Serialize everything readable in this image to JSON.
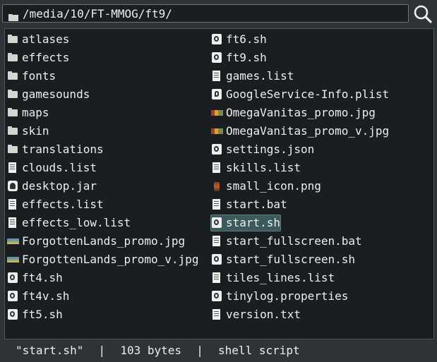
{
  "pathbar": {
    "path": "/media/10/FT-MMOG/ft9/",
    "folder_icon": "folder-icon",
    "search_icon": "search-icon"
  },
  "files": {
    "left": [
      {
        "name": "atlases",
        "icon": "folder"
      },
      {
        "name": "effects",
        "icon": "folder"
      },
      {
        "name": "fonts",
        "icon": "folder"
      },
      {
        "name": "gamesounds",
        "icon": "folder"
      },
      {
        "name": "maps",
        "icon": "folder"
      },
      {
        "name": "skin",
        "icon": "folder"
      },
      {
        "name": "translations",
        "icon": "folder"
      },
      {
        "name": "clouds.list",
        "icon": "text"
      },
      {
        "name": "desktop.jar",
        "icon": "jar"
      },
      {
        "name": "effects.list",
        "icon": "text"
      },
      {
        "name": "effects_low.list",
        "icon": "text"
      },
      {
        "name": "ForgottenLands_promo.jpg",
        "icon": "image"
      },
      {
        "name": "ForgottenLands_promo_v.jpg",
        "icon": "image"
      },
      {
        "name": "ft4.sh",
        "icon": "script"
      },
      {
        "name": "ft4v.sh",
        "icon": "script"
      },
      {
        "name": "ft5.sh",
        "icon": "script"
      }
    ],
    "right": [
      {
        "name": "ft6.sh",
        "icon": "script"
      },
      {
        "name": "ft9.sh",
        "icon": "script"
      },
      {
        "name": "games.list",
        "icon": "text"
      },
      {
        "name": "GoogleService-Info.plist",
        "icon": "plist"
      },
      {
        "name": "OmegaVanitas_promo.jpg",
        "icon": "image2"
      },
      {
        "name": "OmegaVanitas_promo_v.jpg",
        "icon": "image2"
      },
      {
        "name": "settings.json",
        "icon": "script"
      },
      {
        "name": "skills.list",
        "icon": "text"
      },
      {
        "name": "small_icon.png",
        "icon": "png"
      },
      {
        "name": "start.bat",
        "icon": "text"
      },
      {
        "name": "start.sh",
        "icon": "script",
        "selected": true
      },
      {
        "name": "start_fullscreen.bat",
        "icon": "text"
      },
      {
        "name": "start_fullscreen.sh",
        "icon": "script"
      },
      {
        "name": "tiles_lines.list",
        "icon": "text"
      },
      {
        "name": "tinylog.properties",
        "icon": "script"
      },
      {
        "name": "version.txt",
        "icon": "text"
      }
    ]
  },
  "status": {
    "filename": "\"start.sh\"",
    "separator": "|",
    "size": "103 bytes",
    "type": "shell script"
  },
  "colors": {
    "background": "#2e3436",
    "list_background": "#1a1e20",
    "selection": "#3c5a5c",
    "text": "#eeeeec"
  }
}
